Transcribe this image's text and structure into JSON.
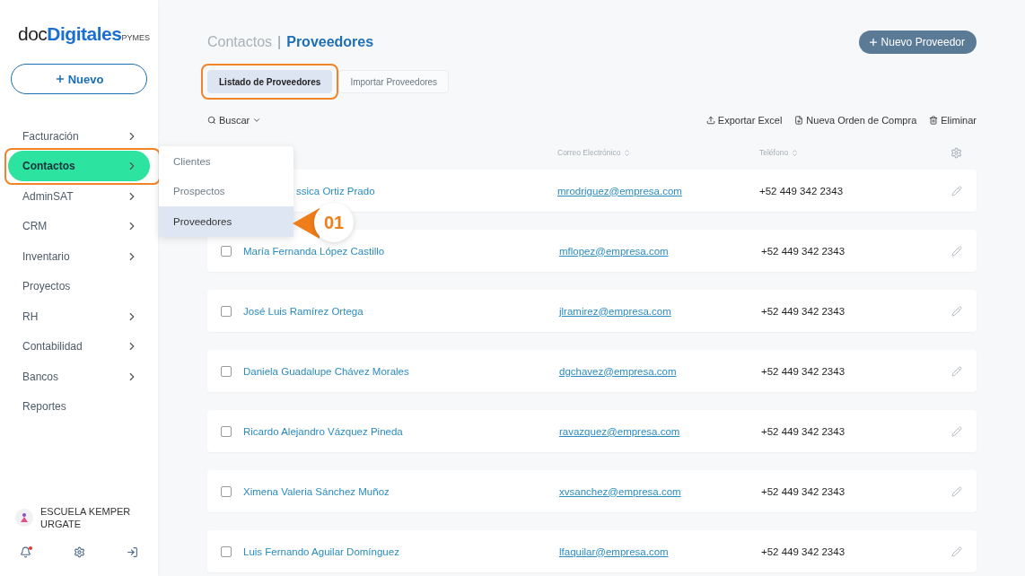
{
  "logo": {
    "part_1": "doc",
    "part_2": "Digitales",
    "part_3": "PYMES"
  },
  "new_button": {
    "label": "Nuevo"
  },
  "sidebar": {
    "items": [
      {
        "label": "Facturación",
        "selected": false,
        "has_children": true
      },
      {
        "label": "Contactos",
        "selected": true,
        "has_children": true,
        "highlighted": true
      },
      {
        "label": "AdminSAT",
        "selected": false,
        "has_children": true
      },
      {
        "label": "CRM",
        "selected": false,
        "has_children": true
      },
      {
        "label": "Inventario",
        "selected": false,
        "has_children": true
      },
      {
        "label": "Proyectos",
        "selected": false,
        "has_children": false
      },
      {
        "label": "RH",
        "selected": false,
        "has_children": true
      },
      {
        "label": "Contabilidad",
        "selected": false,
        "has_children": true
      },
      {
        "label": "Bancos",
        "selected": false,
        "has_children": true
      },
      {
        "label": "Reportes",
        "selected": false,
        "has_children": false
      }
    ]
  },
  "submenu": {
    "items": [
      {
        "label": "Clientes",
        "selected": false
      },
      {
        "label": "Prospectos",
        "selected": false
      },
      {
        "label": "Proveedores",
        "selected": true
      }
    ]
  },
  "callout": {
    "label": "01"
  },
  "user": {
    "name": "ESCUELA KEMPER URGATE",
    "has_notification": true
  },
  "breadcrumb": {
    "parent": "Contactos",
    "separator": "|",
    "current": "Proveedores"
  },
  "primary_button": {
    "label": "Nuevo Proveedor"
  },
  "tabs": [
    {
      "label": "Listado de Proveedores",
      "selected": true,
      "highlighted": true
    },
    {
      "label": "Importar Proveedores",
      "selected": false,
      "highlighted": false
    }
  ],
  "search": {
    "label": "Buscar"
  },
  "actions": [
    {
      "label": "Exportar Excel",
      "kind": "export"
    },
    {
      "label": "Nueva Orden de Compra",
      "kind": "order"
    },
    {
      "label": "Eliminar",
      "kind": "delete"
    }
  ],
  "table": {
    "columns": [
      "Correo Electrónico",
      "Teléfono"
    ],
    "rows": [
      {
        "name": "ssica Ortiz Prado",
        "email": "mrodriguez@empresa.com",
        "phone": "+52 449 342 2343",
        "kind": "covered"
      },
      {
        "name": "María Fernanda López Castillo",
        "email": "mflopez@empresa.com",
        "phone": "+52 449 342 2343",
        "kind": "full",
        "checked": false
      },
      {
        "name": "José Luis Ramírez Ortega",
        "email": "jlramirez@empresa.com",
        "phone": "+52 449 342 2343",
        "kind": "full",
        "checked": false
      },
      {
        "name": "Daniela Guadalupe Chávez Morales",
        "email": "dgchavez@empresa.com",
        "phone": "+52 449 342 2343",
        "kind": "full",
        "checked": false
      },
      {
        "name": "Ricardo Alejandro Vázquez Pineda",
        "email": "ravazquez@empresa.com",
        "phone": "+52 449 342 2343",
        "kind": "full",
        "checked": false
      },
      {
        "name": "Ximena Valeria Sánchez Muñoz",
        "email": "xvsanchez@empresa.com",
        "phone": "+52 449 342 2343",
        "kind": "full",
        "checked": false
      },
      {
        "name": "Luis Fernando Aguilar Domínguez",
        "email": "lfaquilar@empresa.com",
        "phone": "+52 449 342 2343",
        "kind": "full",
        "checked": false
      }
    ]
  }
}
